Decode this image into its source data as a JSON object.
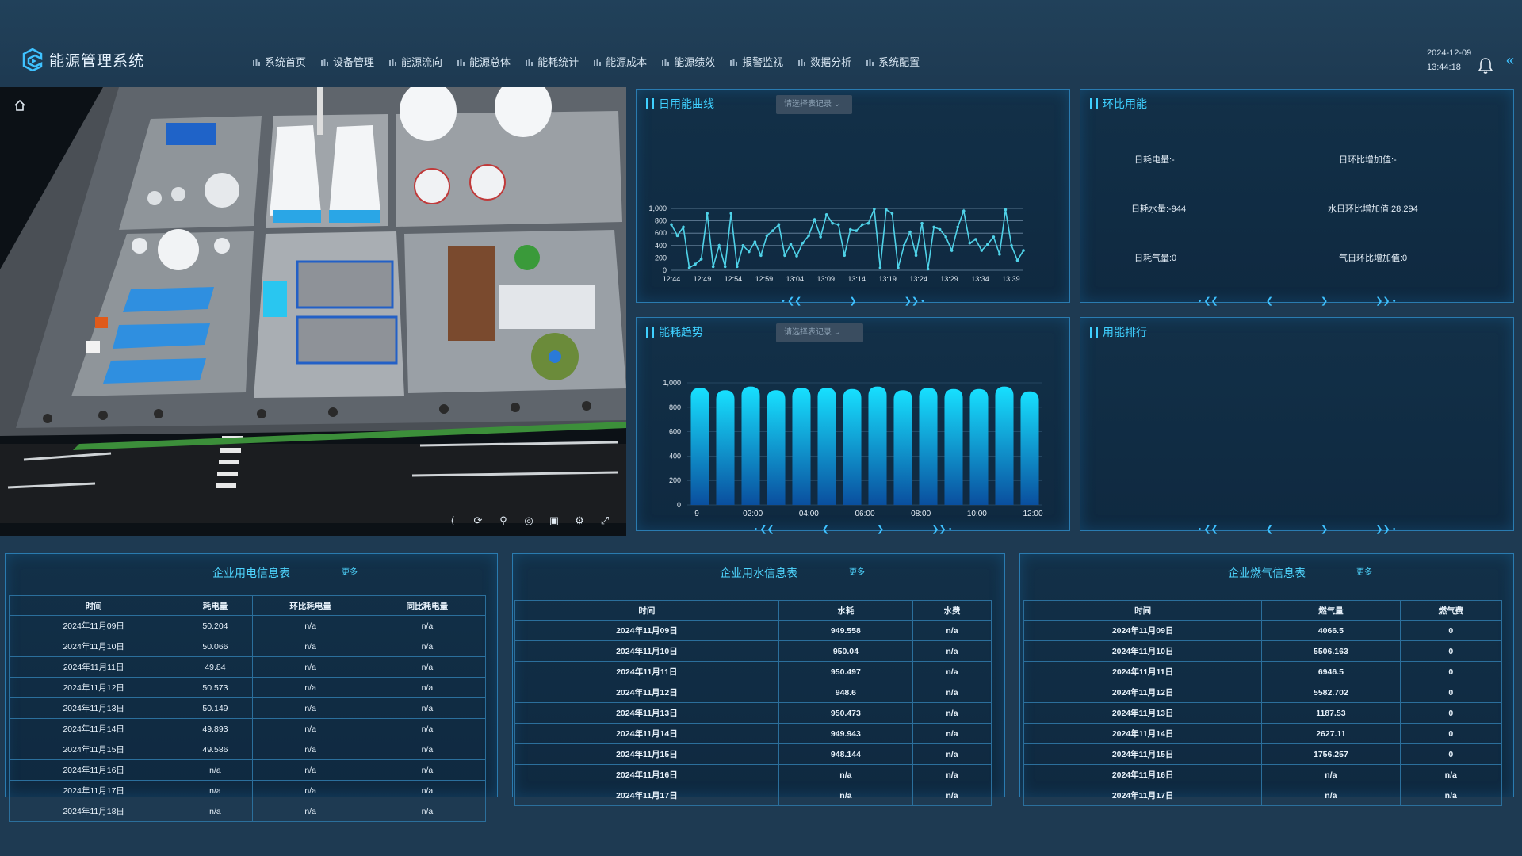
{
  "app": {
    "title": "能源管理系统"
  },
  "nav": [
    {
      "label": "系统首页",
      "icon": "bar-chart-icon"
    },
    {
      "label": "设备管理",
      "icon": "device-icon"
    },
    {
      "label": "能源流向",
      "icon": "flow-icon"
    },
    {
      "label": "能源总体",
      "icon": "database-icon"
    },
    {
      "label": "能耗统计",
      "icon": "stats-icon"
    },
    {
      "label": "能源成本",
      "icon": "document-icon"
    },
    {
      "label": "能源绩效",
      "icon": "bar-chart-icon"
    },
    {
      "label": "报警监视",
      "icon": "star-icon"
    },
    {
      "label": "数据分析",
      "icon": "analysis-icon"
    },
    {
      "label": "系统配置",
      "icon": "gear-icon"
    }
  ],
  "header": {
    "date": "2024-12-09",
    "time": "13:44:18"
  },
  "colors": {
    "accent": "#3fd0ff",
    "line": "#4fd2e8",
    "bar_top": "#17e0ff",
    "bar_bottom": "#0a4f9e",
    "panel_border": "#2a7bb0"
  },
  "panels": {
    "daily_curve": {
      "title": "日用能曲线",
      "select_placeholder": "请选择表记录"
    },
    "ring_ratio": {
      "title": "环比用能",
      "items": [
        {
          "label": "日耗电量:-"
        },
        {
          "label": "日环比增加值:-"
        },
        {
          "label": "日耗水量:-944"
        },
        {
          "label": "水日环比增加值:28.294"
        },
        {
          "label": "日耗气量:0"
        },
        {
          "label": "气日环比增加值:0"
        }
      ]
    },
    "trend": {
      "title": "能耗趋势",
      "select_placeholder": "请选择表记录"
    },
    "ranking": {
      "title": "用能排行"
    }
  },
  "chart_data": [
    {
      "type": "line",
      "y_ticks": [
        "1,000",
        "800",
        "600",
        "400",
        "200",
        "0"
      ],
      "ylim": [
        0,
        1000
      ],
      "x_ticks": [
        "12:44",
        "12:49",
        "12:54",
        "12:59",
        "13:04",
        "13:09",
        "13:14",
        "13:19",
        "13:24",
        "13:29",
        "13:34",
        "13:39"
      ],
      "values": [
        740,
        560,
        700,
        40,
        100,
        180,
        920,
        60,
        400,
        60,
        920,
        60,
        400,
        300,
        460,
        240,
        560,
        640,
        740,
        240,
        420,
        230,
        440,
        560,
        820,
        540,
        900,
        760,
        740,
        240,
        660,
        640,
        740,
        760,
        990,
        40,
        980,
        920,
        40,
        400,
        620,
        240,
        760,
        20,
        700,
        660,
        540,
        320,
        700,
        960,
        440,
        500,
        320,
        420,
        540,
        260,
        980,
        400,
        160,
        320
      ]
    },
    {
      "type": "bar",
      "y_ticks": [
        "1,000",
        "800",
        "600",
        "400",
        "200",
        "0"
      ],
      "ylim": [
        0,
        1000
      ],
      "x_ticks": [
        "9",
        "02:00",
        "04:00",
        "06:00",
        "08:00",
        "10:00",
        "12:00"
      ],
      "values": [
        960,
        940,
        970,
        940,
        960,
        960,
        950,
        970,
        940,
        960,
        950,
        950,
        970,
        930
      ]
    }
  ],
  "tables": {
    "electric": {
      "title": "企业用电信息表",
      "more": "更多",
      "headers": [
        "时间",
        "耗电量",
        "环比耗电量",
        "同比耗电量"
      ],
      "rows": [
        [
          "2024年11月09日",
          "50.204",
          "n/a",
          "n/a"
        ],
        [
          "2024年11月10日",
          "50.066",
          "n/a",
          "n/a"
        ],
        [
          "2024年11月11日",
          "49.84",
          "n/a",
          "n/a"
        ],
        [
          "2024年11月12日",
          "50.573",
          "n/a",
          "n/a"
        ],
        [
          "2024年11月13日",
          "50.149",
          "n/a",
          "n/a"
        ],
        [
          "2024年11月14日",
          "49.893",
          "n/a",
          "n/a"
        ],
        [
          "2024年11月15日",
          "49.586",
          "n/a",
          "n/a"
        ],
        [
          "2024年11月16日",
          "n/a",
          "n/a",
          "n/a"
        ],
        [
          "2024年11月17日",
          "n/a",
          "n/a",
          "n/a"
        ],
        [
          "2024年11月18日",
          "n/a",
          "n/a",
          "n/a"
        ]
      ]
    },
    "water": {
      "title": "企业用水信息表",
      "more": "更多",
      "headers": [
        "时间",
        "水耗",
        "水费"
      ],
      "rows": [
        [
          "2024年11月09日",
          "949.558",
          "n/a"
        ],
        [
          "2024年11月10日",
          "950.04",
          "n/a"
        ],
        [
          "2024年11月11日",
          "950.497",
          "n/a"
        ],
        [
          "2024年11月12日",
          "948.6",
          "n/a"
        ],
        [
          "2024年11月13日",
          "950.473",
          "n/a"
        ],
        [
          "2024年11月14日",
          "949.943",
          "n/a"
        ],
        [
          "2024年11月15日",
          "948.144",
          "n/a"
        ],
        [
          "2024年11月16日",
          "n/a",
          "n/a"
        ],
        [
          "2024年11月17日",
          "n/a",
          "n/a"
        ]
      ]
    },
    "gas": {
      "title": "企业燃气信息表",
      "more": "更多",
      "headers": [
        "时间",
        "燃气量",
        "燃气费"
      ],
      "rows": [
        [
          "2024年11月09日",
          "4066.5",
          "0"
        ],
        [
          "2024年11月10日",
          "5506.163",
          "0"
        ],
        [
          "2024年11月11日",
          "6946.5",
          "0"
        ],
        [
          "2024年11月12日",
          "5582.702",
          "0"
        ],
        [
          "2024年11月13日",
          "1187.53",
          "0"
        ],
        [
          "2024年11月14日",
          "2627.11",
          "0"
        ],
        [
          "2024年11月15日",
          "1756.257",
          "0"
        ],
        [
          "2024年11月16日",
          "n/a",
          "n/a"
        ],
        [
          "2024年11月17日",
          "n/a",
          "n/a"
        ]
      ]
    }
  }
}
